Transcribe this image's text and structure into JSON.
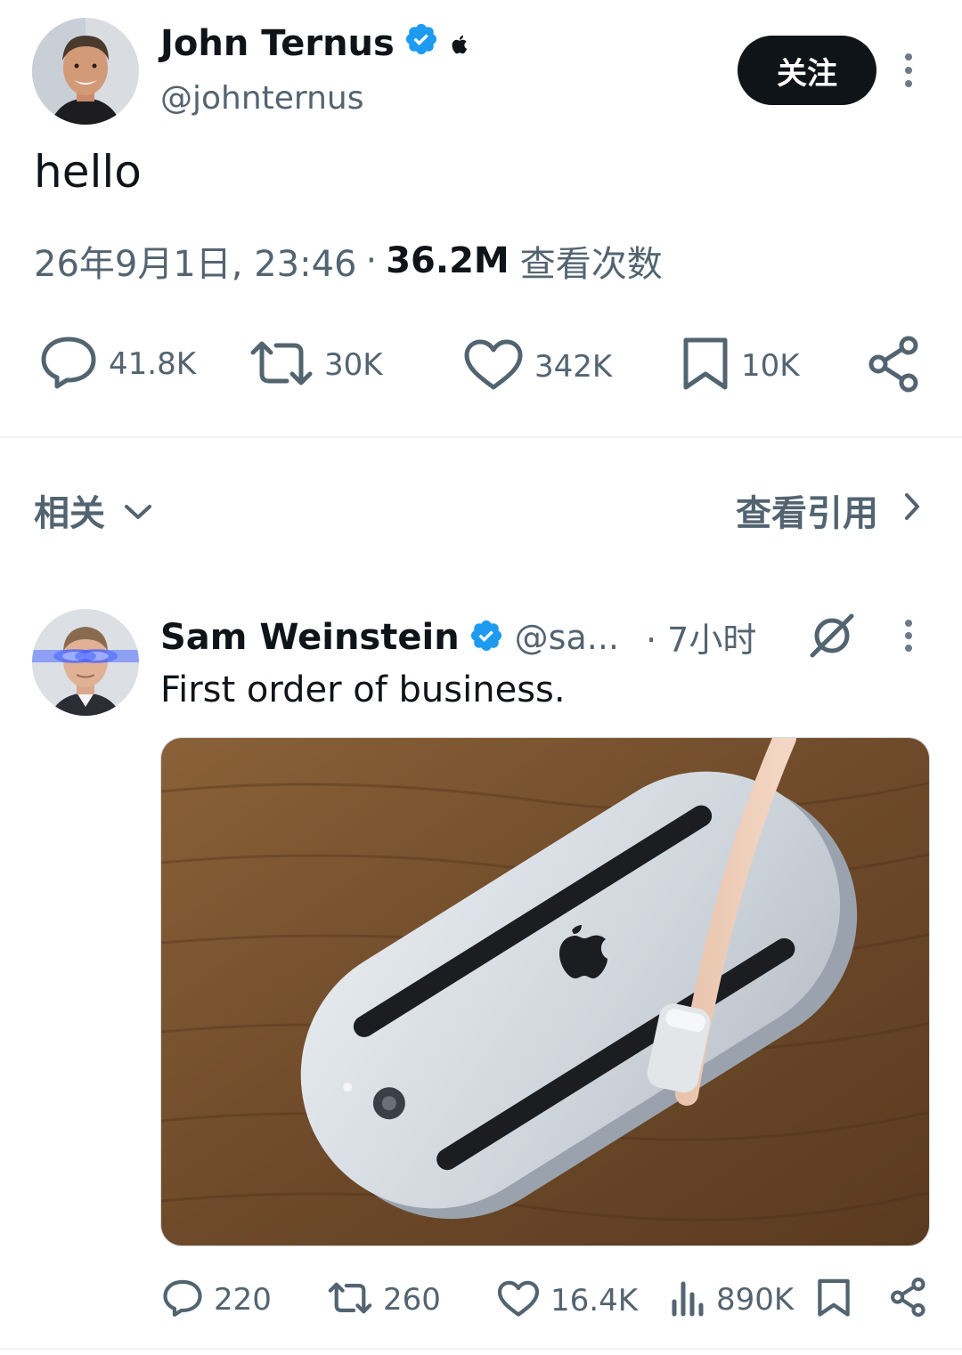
{
  "main_tweet": {
    "author_name": "John Ternus",
    "author_handle": "@johnternus",
    "follow_label": "关注",
    "text": "hello",
    "timestamp": "26年9月1日, 23:46",
    "separator": "·",
    "views": "36.2M",
    "views_label": "查看次数",
    "actions": {
      "replies": "41.8K",
      "reposts": "30K",
      "likes": "342K",
      "bookmarks": "10K"
    }
  },
  "section_bar": {
    "related_label": "相关",
    "view_quotes_label": "查看引用"
  },
  "reply_tweet": {
    "author_name": "Sam Weinstein",
    "author_handle": "@sa...",
    "time": "· 7小时",
    "text": "First order of business.",
    "actions": {
      "replies": "220",
      "reposts": "260",
      "likes": "16.4K",
      "views": "890K"
    }
  },
  "colors": {
    "text_primary": "#0f1419",
    "text_secondary": "#536471",
    "verified_blue": "#1d9bf0",
    "follow_bg": "#0f1419",
    "divider": "#eff3f4"
  },
  "icons": [
    "verified-badge-icon",
    "apple-logo-icon",
    "more-icon",
    "reply-icon",
    "repost-icon",
    "like-icon",
    "bookmark-icon",
    "share-icon",
    "chevron-down-icon",
    "chevron-right-icon",
    "grok-icon",
    "views-icon"
  ]
}
